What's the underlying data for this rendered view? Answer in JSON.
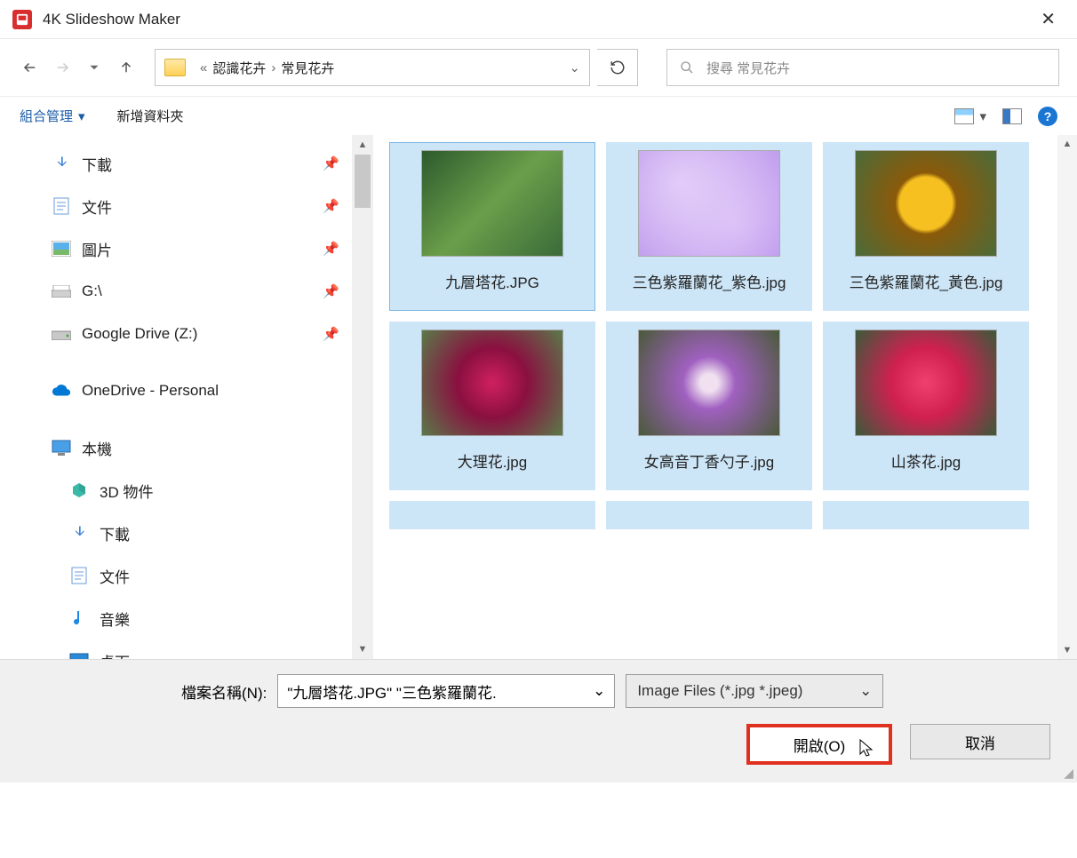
{
  "title": "4K Slideshow Maker",
  "breadcrumb": {
    "sep": "«",
    "p1": "認識花卉",
    "p2": "常見花卉"
  },
  "search": {
    "placeholder": "搜尋 常見花卉"
  },
  "toolbar": {
    "organize": "組合管理",
    "newfolder": "新增資料夾",
    "help": "?"
  },
  "sidebar": [
    {
      "label": "下載",
      "icon": "download",
      "pin": true
    },
    {
      "label": "文件",
      "icon": "doc",
      "pin": true
    },
    {
      "label": "圖片",
      "icon": "pic",
      "pin": true
    },
    {
      "label": "G:\\",
      "icon": "drive",
      "pin": true
    },
    {
      "label": "Google Drive (Z:)",
      "icon": "gdrive",
      "pin": true
    },
    {
      "label": "OneDrive - Personal",
      "icon": "onedrive",
      "spaced": true
    },
    {
      "label": "本機",
      "icon": "pc",
      "spaced": true
    },
    {
      "label": "3D 物件",
      "icon": "3d",
      "sub": true
    },
    {
      "label": "下載",
      "icon": "download",
      "sub": true
    },
    {
      "label": "文件",
      "icon": "doc",
      "sub": true
    },
    {
      "label": "音樂",
      "icon": "music",
      "sub": true
    },
    {
      "label": "桌面",
      "icon": "desktop",
      "sub": true
    }
  ],
  "files": [
    {
      "name": "九層塔花.JPG",
      "cls": "img-green"
    },
    {
      "name": "三色紫羅蘭花_紫色.jpg",
      "cls": "img-purple"
    },
    {
      "name": "三色紫羅蘭花_黃色.jpg",
      "cls": "img-yellow"
    },
    {
      "name": "大理花.jpg",
      "cls": "img-magenta"
    },
    {
      "name": "女高音丁香勺子.jpg",
      "cls": "img-spiky"
    },
    {
      "name": "山茶花.jpg",
      "cls": "img-pink"
    }
  ],
  "footer": {
    "fname_label": "檔案名稱(N):",
    "fname_value": "\"九層塔花.JPG\" \"三色紫羅蘭花.",
    "filter": "Image Files (*.jpg *.jpeg)",
    "open": "開啟(O)",
    "cancel": "取消"
  }
}
